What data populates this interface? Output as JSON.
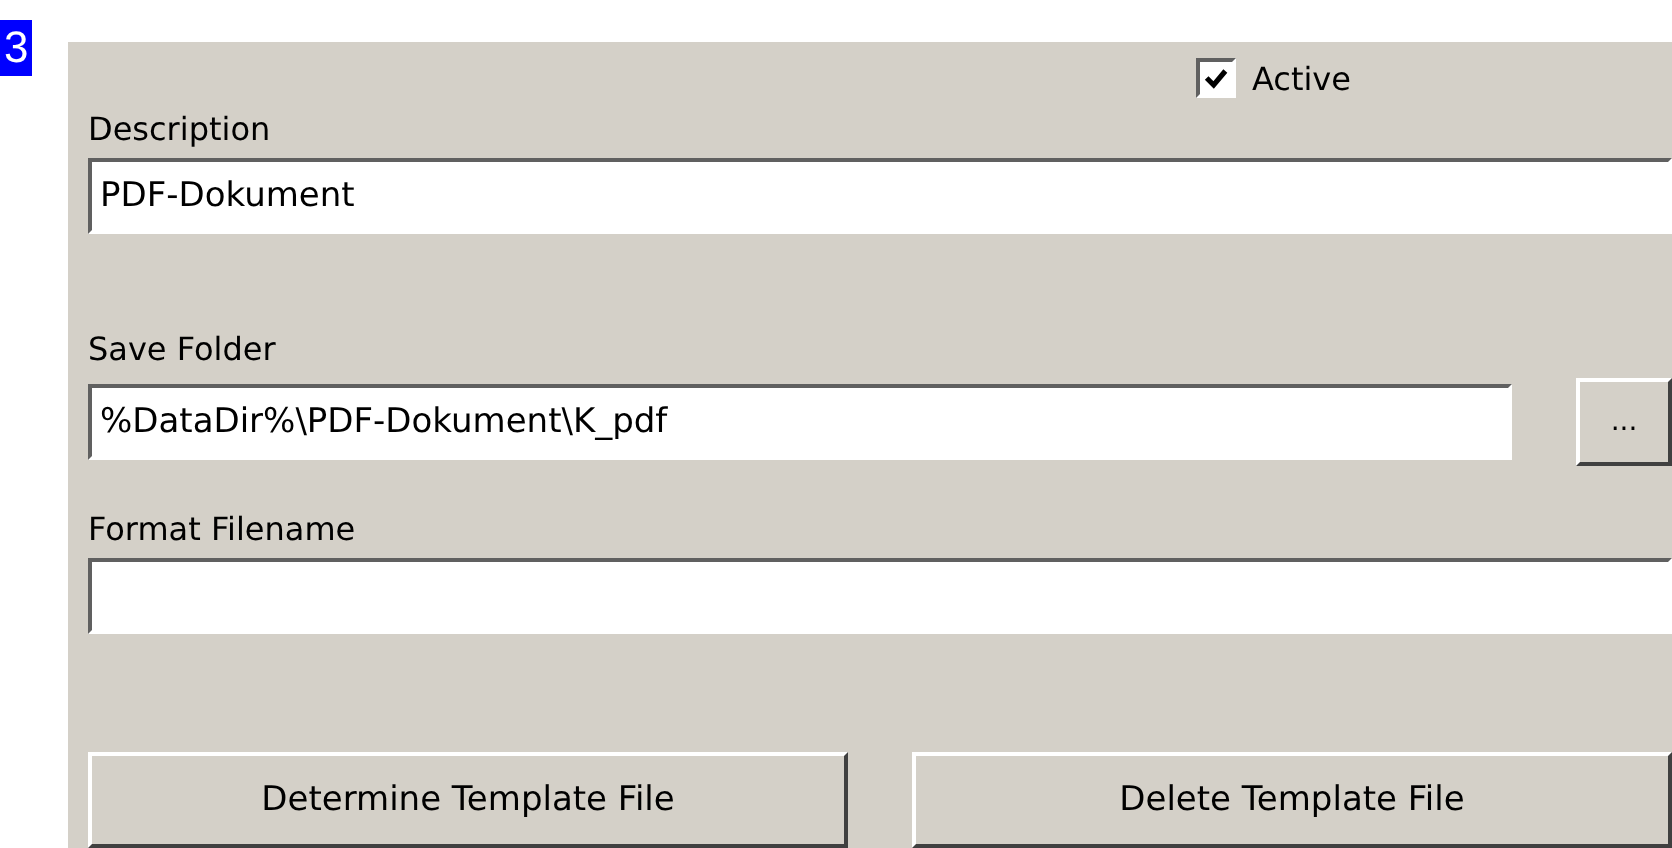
{
  "step_badge": "3",
  "active": {
    "label": "Active",
    "checked": true
  },
  "fields": [
    {
      "label": "Description",
      "value": "PDF-Dokument"
    },
    {
      "label": "Save Folder",
      "value": "%DataDir%\\PDF-Dokument\\K_pdf",
      "browse_label": "..."
    },
    {
      "label": "Format Filename"
    }
  ],
  "buttons": [
    "Determine Template File",
    "Delete Template File"
  ]
}
